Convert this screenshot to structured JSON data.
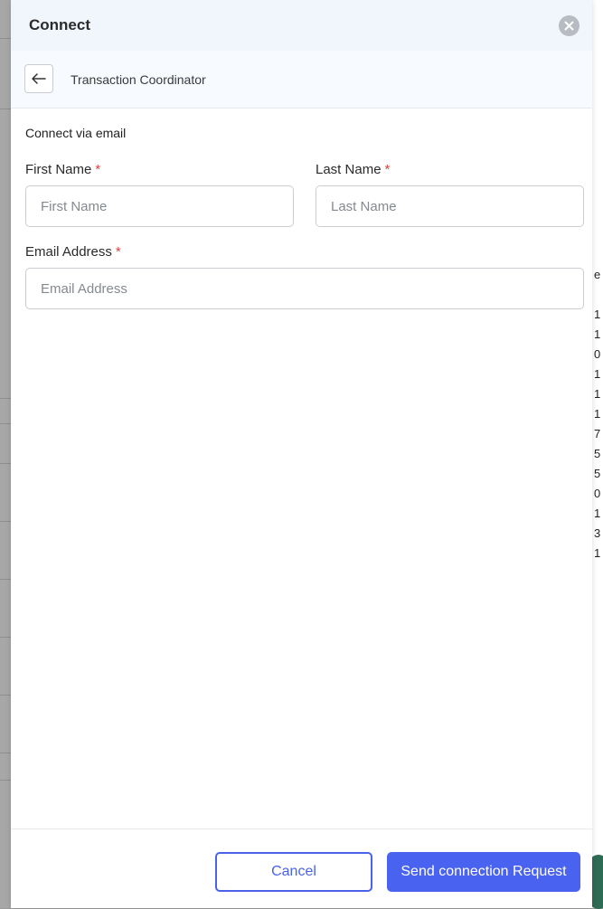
{
  "drawer": {
    "title": "Connect",
    "subheader_title": "Transaction Coordinator",
    "section_title": "Connect via email"
  },
  "form": {
    "first_name": {
      "label": "First Name",
      "placeholder": "First Name",
      "value": ""
    },
    "last_name": {
      "label": "Last Name",
      "placeholder": "Last Name",
      "value": ""
    },
    "email": {
      "label": "Email Address",
      "placeholder": "Email Address",
      "value": ""
    },
    "required_marker": "*"
  },
  "footer": {
    "cancel_label": "Cancel",
    "send_label": "Send connection Request"
  },
  "colors": {
    "accent": "#4a62f0",
    "required": "#e04040",
    "header_bg": "#f1f6fd"
  },
  "icons": {
    "close": "close-icon",
    "back": "arrow-left-icon"
  },
  "background_page": {
    "visible_chars": [
      "e",
      "1",
      "1",
      "0",
      "1",
      "1",
      "1",
      "7",
      "5",
      "5",
      "0",
      "1",
      "3",
      "1"
    ]
  }
}
